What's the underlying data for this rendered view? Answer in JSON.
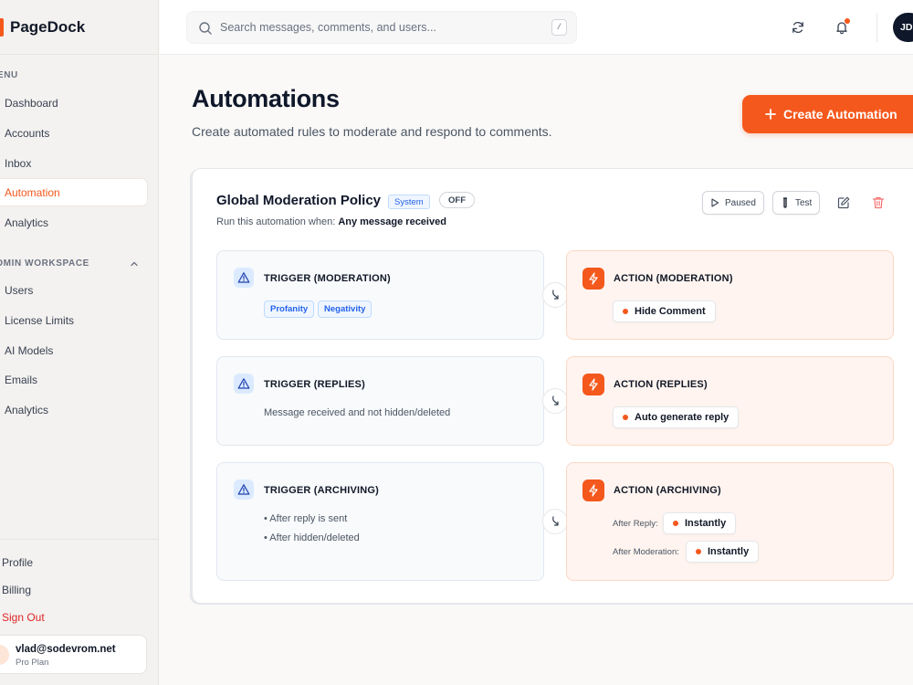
{
  "app": {
    "name": "PageDock"
  },
  "sidebar": {
    "menu_label": "MENU",
    "menu_items": [
      {
        "label": "Dashboard"
      },
      {
        "label": "Accounts"
      },
      {
        "label": "Inbox"
      },
      {
        "label": "Automation",
        "active": true
      },
      {
        "label": "Analytics"
      }
    ],
    "admin_label": "ADMIN WORKSPACE",
    "admin_items": [
      {
        "label": "Users"
      },
      {
        "label": "License Limits"
      },
      {
        "label": "AI Models"
      },
      {
        "label": "Emails"
      },
      {
        "label": "Analytics"
      }
    ],
    "bottom_links": [
      {
        "label": "Profile"
      },
      {
        "label": "Billing"
      },
      {
        "label": "Sign Out"
      }
    ],
    "user": {
      "email": "vlad@sodevrom.net",
      "plan": "Pro Plan"
    }
  },
  "topbar": {
    "search_placeholder": "Search messages, comments, and users...",
    "search_shortcut": "/",
    "avatar_initials": "JD"
  },
  "page": {
    "title": "Automations",
    "subtitle": "Create automated rules to moderate and respond to comments.",
    "create_button": "Create Automation"
  },
  "automation": {
    "name": "Global Moderation Policy",
    "system_badge": "System",
    "status_badge": "OFF",
    "run_when_prefix": "Run this automation when:",
    "run_when_value": "Any message received",
    "paused_label": "Paused",
    "test_label": "Test",
    "rows": [
      {
        "trigger_title": "TRIGGER (MODERATION)",
        "trigger_chips": [
          "Profanity",
          "Negativity"
        ],
        "action_title": "ACTION (MODERATION)",
        "action_value": "Hide Comment"
      },
      {
        "trigger_title": "TRIGGER (REPLIES)",
        "trigger_text": "Message received and not hidden/deleted",
        "action_title": "ACTION (REPLIES)",
        "action_value": "Auto generate reply"
      },
      {
        "trigger_title": "TRIGGER (ARCHIVING)",
        "trigger_bullets": [
          "• After reply is sent",
          "• After hidden/deleted"
        ],
        "action_title": "ACTION (ARCHIVING)",
        "after_reply_label": "After Reply:",
        "after_reply_value": "Instantly",
        "after_moderation_label": "After Moderation:",
        "after_moderation_value": "Instantly"
      }
    ]
  },
  "colors": {
    "accent": "#f4581c",
    "trigger_bg": "#f8fafc",
    "action_bg": "#fff4ef",
    "danger": "#dc2626"
  }
}
